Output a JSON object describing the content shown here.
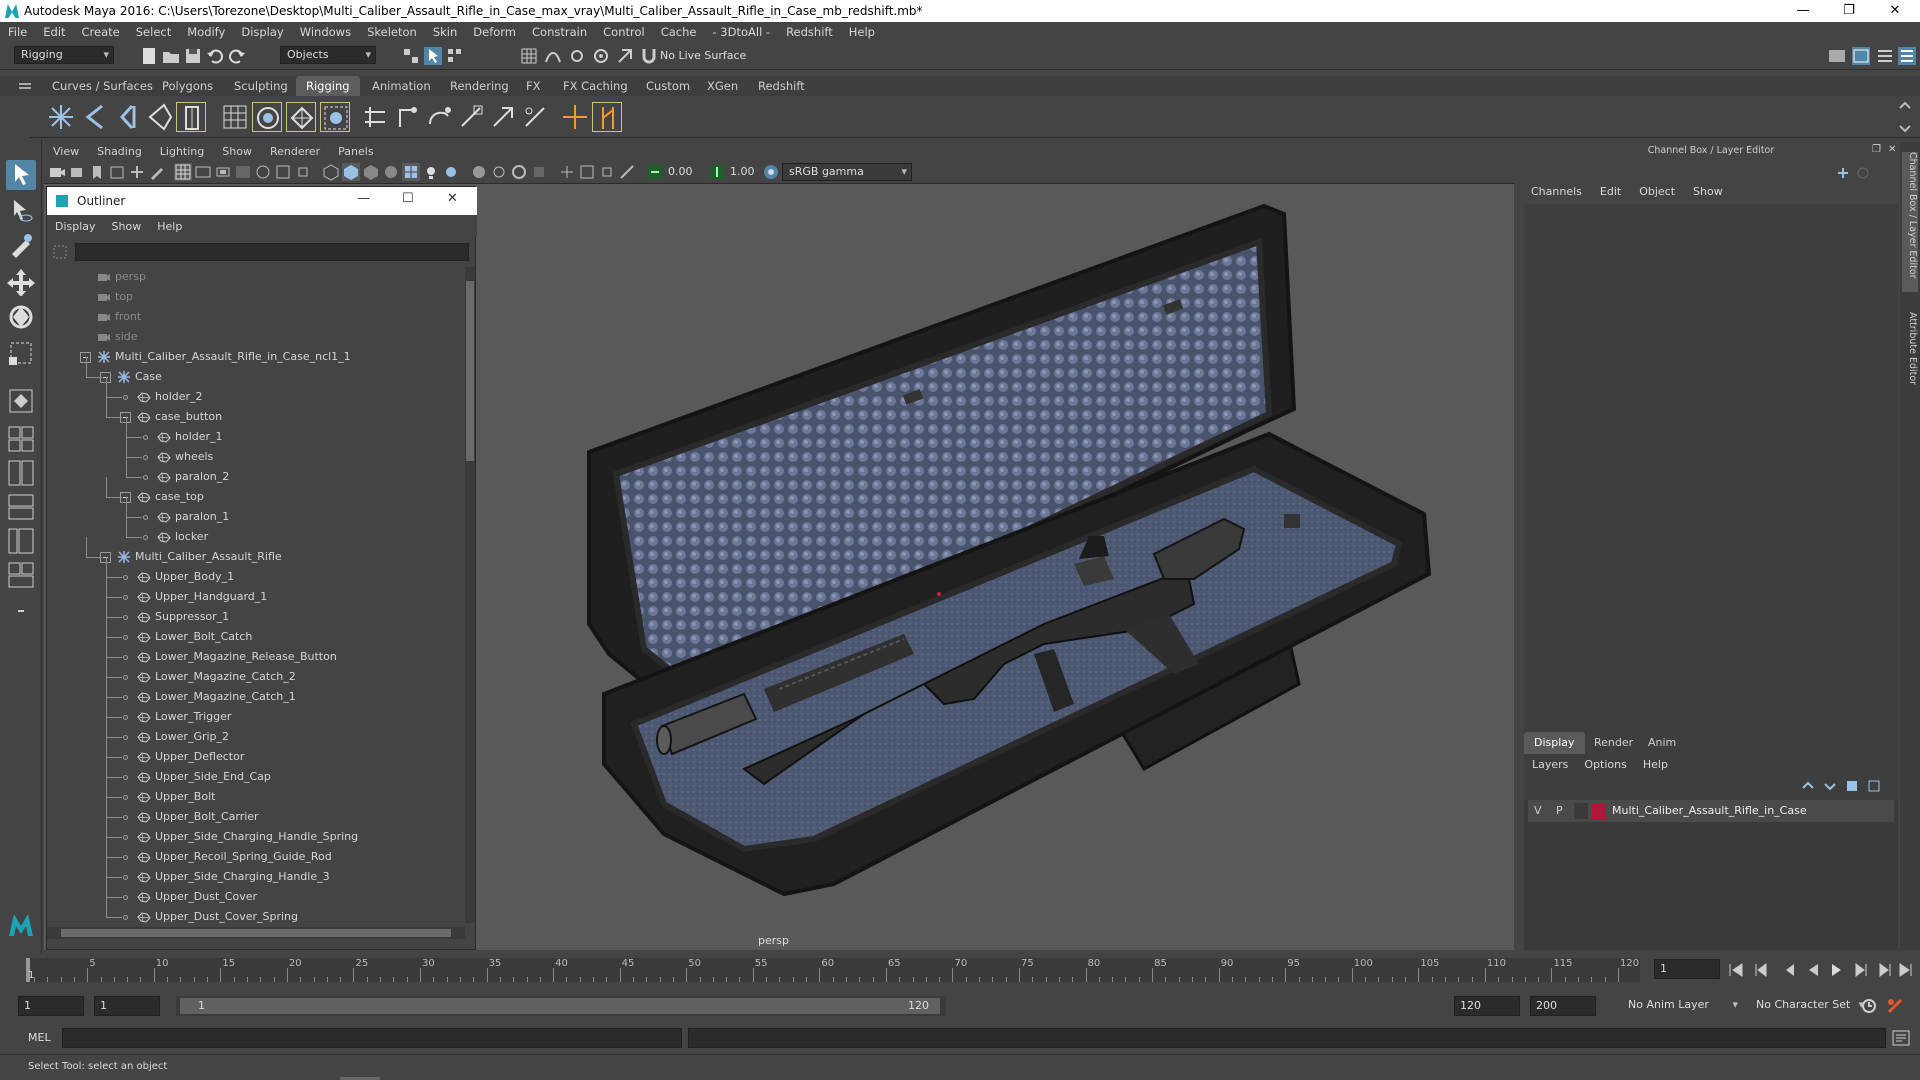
{
  "window": {
    "title": "Autodesk Maya 2016: C:\\Users\\Torezone\\Desktop\\Multi_Caliber_Assault_Rifle_in_Case_max_vray\\Multi_Caliber_Assault_Rifle_in_Case_mb_redshift.mb*",
    "minimize": "—",
    "maximize": "❐",
    "close": "✕"
  },
  "menubar": [
    "File",
    "Edit",
    "Create",
    "Select",
    "Modify",
    "Display",
    "Windows",
    "Skeleton",
    "Skin",
    "Deform",
    "Constrain",
    "Control",
    "Cache",
    "- 3DtoAll -",
    "Redshift",
    "Help"
  ],
  "statusline": {
    "mode": "Rigging",
    "selection": "Objects",
    "live_surface": "No Live Surface"
  },
  "shelf_tabs": [
    "Curves / Surfaces",
    "Polygons",
    "Sculpting",
    "Rigging",
    "Animation",
    "Rendering",
    "FX",
    "FX Caching",
    "Custom",
    "XGen",
    "Redshift"
  ],
  "shelf_active": "Rigging",
  "viewport": {
    "menu": [
      "View",
      "Shading",
      "Lighting",
      "Show",
      "Renderer",
      "Panels"
    ],
    "exposure": "0.00",
    "gamma": "1.00",
    "colorspace": "sRGB gamma",
    "camera": "persp"
  },
  "outliner": {
    "title": "Outliner",
    "menu": [
      "Display",
      "Show",
      "Help"
    ],
    "items": [
      {
        "label": "persp",
        "depth": 0,
        "kind": "camera",
        "dim": true
      },
      {
        "label": "top",
        "depth": 0,
        "kind": "camera",
        "dim": true
      },
      {
        "label": "front",
        "depth": 0,
        "kind": "camera",
        "dim": true
      },
      {
        "label": "side",
        "depth": 0,
        "kind": "camera",
        "dim": true
      },
      {
        "label": "Multi_Caliber_Assault_Rifle_in_Case_ncl1_1",
        "depth": 0,
        "kind": "group",
        "expanded": true
      },
      {
        "label": "Case",
        "depth": 1,
        "kind": "group",
        "expanded": true
      },
      {
        "label": "holder_2",
        "depth": 2,
        "kind": "mesh"
      },
      {
        "label": "case_button",
        "depth": 2,
        "kind": "mesh",
        "expanded": true
      },
      {
        "label": "holder_1",
        "depth": 3,
        "kind": "mesh"
      },
      {
        "label": "wheels",
        "depth": 3,
        "kind": "mesh"
      },
      {
        "label": "paralon_2",
        "depth": 3,
        "kind": "mesh"
      },
      {
        "label": "case_top",
        "depth": 2,
        "kind": "mesh",
        "expanded": true
      },
      {
        "label": "paralon_1",
        "depth": 3,
        "kind": "mesh"
      },
      {
        "label": "locker",
        "depth": 3,
        "kind": "mesh"
      },
      {
        "label": "Multi_Caliber_Assault_Rifle",
        "depth": 1,
        "kind": "group",
        "expanded": true
      },
      {
        "label": "Upper_Body_1",
        "depth": 2,
        "kind": "mesh"
      },
      {
        "label": "Upper_Handguard_1",
        "depth": 2,
        "kind": "mesh"
      },
      {
        "label": "Suppressor_1",
        "depth": 2,
        "kind": "mesh"
      },
      {
        "label": "Lower_Bolt_Catch",
        "depth": 2,
        "kind": "mesh"
      },
      {
        "label": "Lower_Magazine_Release_Button",
        "depth": 2,
        "kind": "mesh"
      },
      {
        "label": "Lower_Magazine_Catch_2",
        "depth": 2,
        "kind": "mesh"
      },
      {
        "label": "Lower_Magazine_Catch_1",
        "depth": 2,
        "kind": "mesh"
      },
      {
        "label": "Lower_Trigger",
        "depth": 2,
        "kind": "mesh"
      },
      {
        "label": "Lower_Grip_2",
        "depth": 2,
        "kind": "mesh"
      },
      {
        "label": "Upper_Deflector",
        "depth": 2,
        "kind": "mesh"
      },
      {
        "label": "Upper_Side_End_Cap",
        "depth": 2,
        "kind": "mesh"
      },
      {
        "label": "Upper_Bolt",
        "depth": 2,
        "kind": "mesh"
      },
      {
        "label": "Upper_Bolt_Carrier",
        "depth": 2,
        "kind": "mesh"
      },
      {
        "label": "Upper_Side_Charging_Handle_Spring",
        "depth": 2,
        "kind": "mesh"
      },
      {
        "label": "Upper_Recoil_Spring_Guide_Rod",
        "depth": 2,
        "kind": "mesh"
      },
      {
        "label": "Upper_Side_Charging_Handle_3",
        "depth": 2,
        "kind": "mesh"
      },
      {
        "label": "Upper_Dust_Cover",
        "depth": 2,
        "kind": "mesh"
      },
      {
        "label": "Upper_Dust_Cover_Spring",
        "depth": 2,
        "kind": "mesh"
      }
    ]
  },
  "channel_box": {
    "header": "Channel Box / Layer Editor",
    "menu": [
      "Channels",
      "Edit",
      "Object",
      "Show"
    ]
  },
  "layer_editor": {
    "tabs": [
      "Display",
      "Render",
      "Anim"
    ],
    "active_tab": "Display",
    "menu": [
      "Layers",
      "Options",
      "Help"
    ],
    "layers": [
      {
        "v": "V",
        "p": "P",
        "name": "Multi_Caliber_Assault_Rifle_in_Case",
        "color": "#b0163a"
      }
    ]
  },
  "side_tabs": [
    "Channel Box / Layer Editor",
    "Attribute Editor"
  ],
  "timeline": {
    "ticks": [
      "5",
      "10",
      "15",
      "20",
      "25",
      "30",
      "35",
      "40",
      "45",
      "50",
      "55",
      "60",
      "65",
      "70",
      "75",
      "80",
      "85",
      "90",
      "95",
      "100",
      "105",
      "110",
      "115",
      "120"
    ],
    "current_marker": "1",
    "current_frame": "1"
  },
  "range": {
    "start": "1",
    "playback_start": "1",
    "slider_start": "1",
    "slider_end": "120",
    "playback_end": "120",
    "end": "200",
    "anim_layer": "No Anim Layer",
    "character_set": "No Character Set"
  },
  "command": {
    "lang": "MEL"
  },
  "help_line": "Select Tool: select an object",
  "colors": {
    "accent": "#5285a6",
    "layer_red": "#b0163a",
    "foam": "#465069",
    "case": "#1f1f1f"
  }
}
